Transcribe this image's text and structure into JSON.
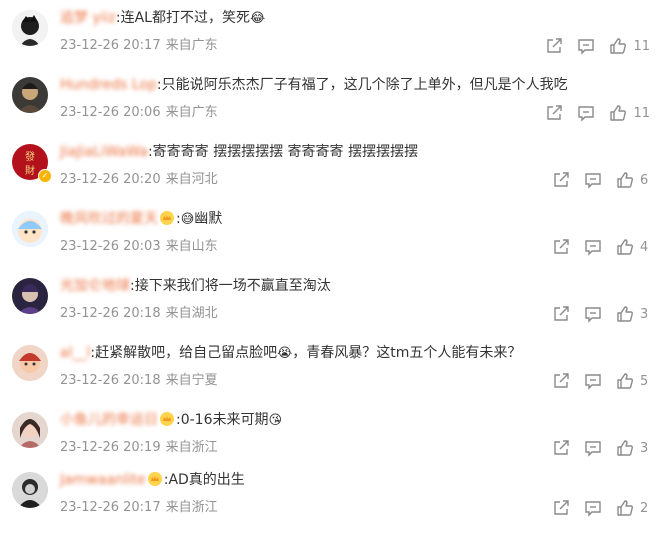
{
  "comments": [
    {
      "user": "追梦 yiiz",
      "colon": ":",
      "text": "连AL都打不过，笑死",
      "emoji": "😂",
      "crown": false,
      "time": "23-12-26 20:17",
      "location": "来自广东",
      "likes": "11",
      "verified": false
    },
    {
      "user": "Hundreds Lop",
      "colon": ":",
      "text": "只能说阿乐杰杰厂子有福了，这几个除了上单外，但凡是个人我吃",
      "emoji": "",
      "crown": false,
      "time": "23-12-26 20:06",
      "location": "来自广东",
      "likes": "11",
      "verified": false
    },
    {
      "user": "JiaJiaLiWaWa",
      "colon": ":",
      "text": "寄寄寄寄 摆摆摆摆摆 寄寄寄寄 摆摆摆摆摆",
      "emoji": "",
      "crown": false,
      "time": "23-12-26 20:20",
      "location": "来自河北",
      "likes": "6",
      "verified": true
    },
    {
      "user": "晚风吹过的夏天",
      "colon": ":",
      "text": "幽默",
      "emoji": "😅",
      "crown": true,
      "time": "23-12-26 20:03",
      "location": "来自山东",
      "likes": "4",
      "verified": false
    },
    {
      "user": "光加仑地球",
      "colon": ":",
      "text": "接下来我们将一场不赢直至淘汰",
      "emoji": "",
      "crown": false,
      "time": "23-12-26 20:18",
      "location": "来自湖北",
      "likes": "3",
      "verified": false
    },
    {
      "user": "al__l",
      "colon": ":",
      "text": "赶紧解散吧，给自己留点脸吧",
      "text2": "，青春风暴？这tm五个人能有未来？",
      "emoji": "😭",
      "crown": false,
      "time": "23-12-26 20:18",
      "location": "来自宁夏",
      "likes": "5",
      "verified": false
    },
    {
      "user": "小鱼儿的幸运日",
      "colon": ":",
      "text": "0-16未来可期",
      "emoji": "😘",
      "crown": true,
      "time": "23-12-26 20:19",
      "location": "来自浙江",
      "likes": "3",
      "verified": false
    },
    {
      "user": "Jamwaanlite",
      "colon": ":",
      "text": "AD真的出生",
      "emoji": "",
      "crown": true,
      "time": "23-12-26 20:17",
      "location": "来自浙江",
      "likes": "2",
      "verified": false
    }
  ],
  "actions": {
    "share": "share-icon",
    "comment": "comment-icon",
    "like": "like-icon"
  },
  "colors": {
    "username": "#eb7340",
    "meta": "#939393",
    "text": "#333333"
  }
}
